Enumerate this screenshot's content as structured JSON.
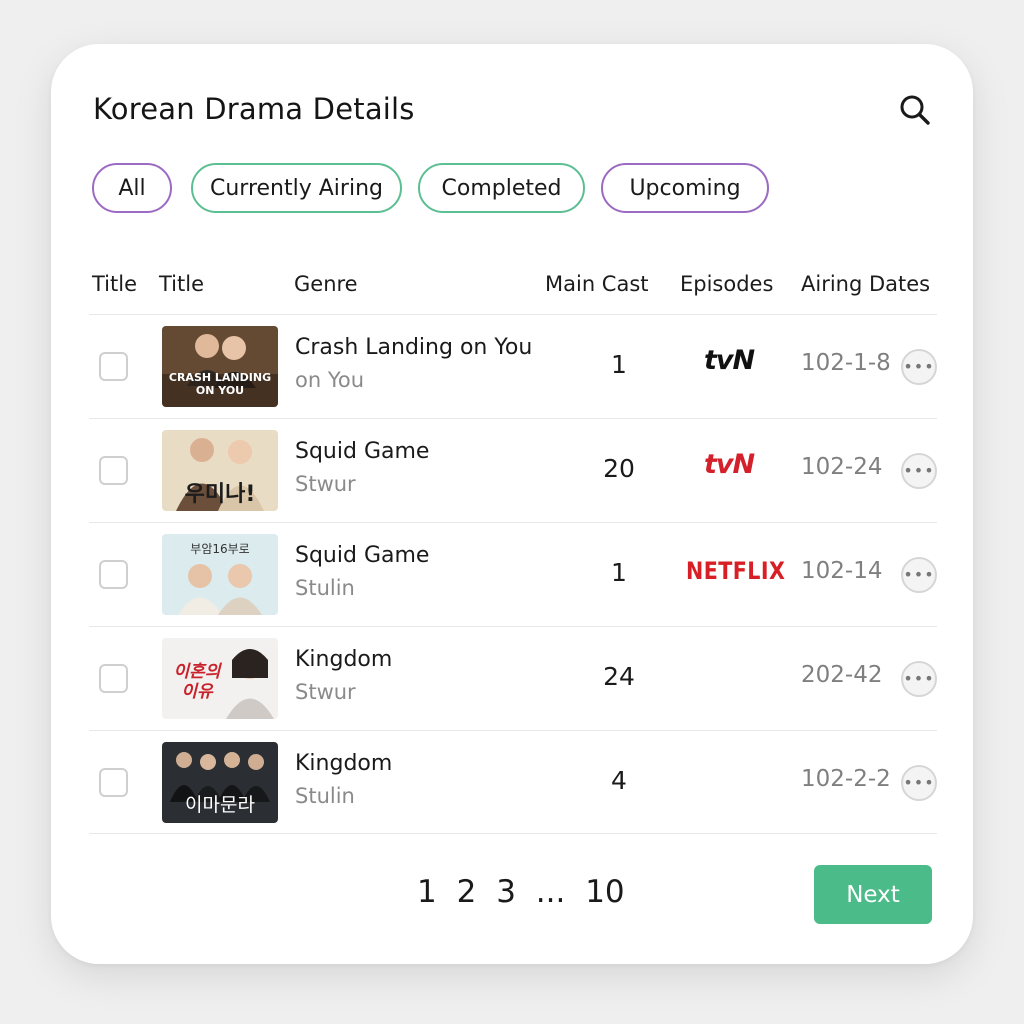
{
  "header": {
    "title": "Korean Drama Details",
    "search_icon": "search-icon"
  },
  "filters": [
    {
      "label": "All",
      "accent": "#9b6bc4"
    },
    {
      "label": "Currently Airing",
      "accent": "#5cbf93"
    },
    {
      "label": "Completed",
      "accent": "#5cbf93"
    },
    {
      "label": "Upcoming",
      "accent": "#9b6bc4"
    }
  ],
  "columns": [
    "Title",
    "Title",
    "Genre",
    "Main Cast",
    "Episodes",
    "Airing Dates"
  ],
  "rows": [
    {
      "title": "Crash Landing on You",
      "subtitle": "on You",
      "episodes": "1",
      "network": "tvN",
      "network_color": "#111111",
      "dates": "102-1-8",
      "thumb_text": "CRASH LANDING ON YOU"
    },
    {
      "title": "Squid Game",
      "subtitle": "Stwur",
      "episodes": "20",
      "network": "tvN",
      "network_color": "#d4202a",
      "dates": "102-24",
      "thumb_text": "우미나!"
    },
    {
      "title": "Squid Game",
      "subtitle": "Stulin",
      "episodes": "1",
      "network": "NETFLIX",
      "network_color": "#d81f26",
      "dates": "102-14",
      "thumb_text": "부암16부로"
    },
    {
      "title": "Kingdom",
      "subtitle": "Stwur",
      "episodes": "24",
      "network": "",
      "network_color": "#111111",
      "dates": "202-42",
      "thumb_text": "이혼의 이유"
    },
    {
      "title": "Kingdom",
      "subtitle": "Stulin",
      "episodes": "4",
      "network": "",
      "network_color": "#111111",
      "dates": "102-2-2",
      "thumb_text": "이마문라"
    }
  ],
  "pagination": {
    "pages": [
      "1",
      "2",
      "3",
      "...",
      "10"
    ],
    "next_label": "Next",
    "next_color": "#4cbb8a"
  },
  "icons": {
    "more": "more-horizontal-icon",
    "checkbox": "checkbox-icon"
  }
}
